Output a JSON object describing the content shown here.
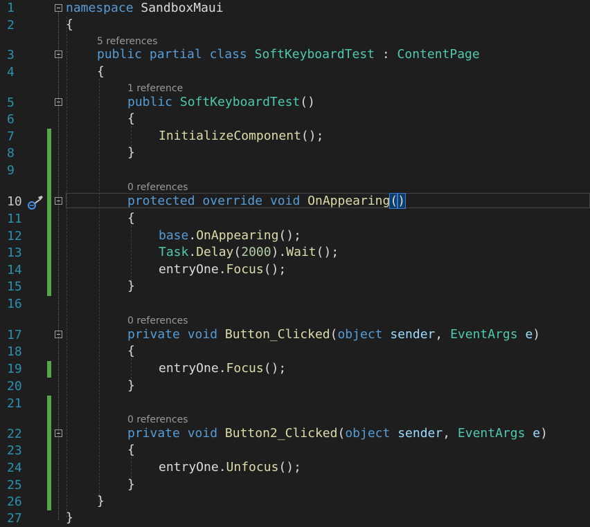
{
  "editor": {
    "line_numbers": [
      "1",
      "2",
      "3",
      "4",
      "5",
      "6",
      "7",
      "8",
      "9",
      "10",
      "11",
      "12",
      "13",
      "14",
      "15",
      "16",
      "17",
      "18",
      "19",
      "20",
      "21",
      "22",
      "23",
      "24",
      "25",
      "26",
      "27"
    ],
    "references": {
      "class_refs": "5 references",
      "ctor_refs": "1 reference",
      "on_appearing_refs": "0 references",
      "button_clicked_refs": "0 references",
      "button2_clicked_refs": "0 references"
    },
    "code": {
      "l1_kw": "namespace",
      "l1_name": " SandboxMaui",
      "open_brace": "{",
      "close_brace": "}",
      "l3_public": "public",
      "l3_partial": "partial",
      "l3_class": "class",
      "l3_name": "SoftKeyboardTest",
      "l3_colon": " : ",
      "l3_base": "ContentPage",
      "l5_public": "public",
      "l5_name": "SoftKeyboardTest",
      "l5_parens": "()",
      "l7_fn": "InitializeComponent",
      "l7_rest": "();",
      "l10_protected": "protected",
      "l10_override": "override",
      "l10_void": "void",
      "l10_name": "OnAppearing",
      "l10_open_paren": "(",
      "l10_close_paren": ")",
      "l12_base": "base",
      "l12_dot": ".",
      "l12_fn": "OnAppearing",
      "l12_rest": "();",
      "l13_task": "Task",
      "l13_dot": ".",
      "l13_fn": "Delay",
      "l13_open": "(",
      "l13_num": "2000",
      "l13_close": ")",
      "l13_dot2": ".",
      "l13_fn2": "Wait",
      "l13_rest": "();",
      "l14_ident": "entryOne",
      "l14_dot": ".",
      "l14_fn": "Focus",
      "l14_rest": "();",
      "l17_private": "private",
      "l17_void": "void",
      "l17_name": "Button_Clicked",
      "l17_open": "(",
      "l17_object": "object",
      "l17_sender": "sender",
      "l17_comma": ", ",
      "l17_eventargs": "EventArgs",
      "l17_e": "e",
      "l17_close": ")",
      "l19_ident": "entryOne",
      "l19_dot": ".",
      "l19_fn": "Focus",
      "l19_rest": "();",
      "l22_private": "private",
      "l22_void": "void",
      "l22_name": "Button2_Clicked",
      "l22_open": "(",
      "l22_object": "object",
      "l22_sender": "sender",
      "l22_comma": ", ",
      "l22_eventargs": "EventArgs",
      "l22_e": "e",
      "l22_close": ")",
      "l24_ident": "entryOne",
      "l24_dot": ".",
      "l24_fn": "Unfocus",
      "l24_rest": "();"
    },
    "colors": {
      "background": "#1e1e1e",
      "keyword": "#569cd6",
      "type": "#4ec9b0",
      "method": "#dcdcaa",
      "number": "#b5cea8",
      "parameter": "#9cdcfe",
      "line_number": "#2b91af",
      "change_bar": "#57a64a"
    },
    "icons": {
      "quick_action": "paintbrush-icon",
      "fold": "collapse-icon"
    }
  }
}
